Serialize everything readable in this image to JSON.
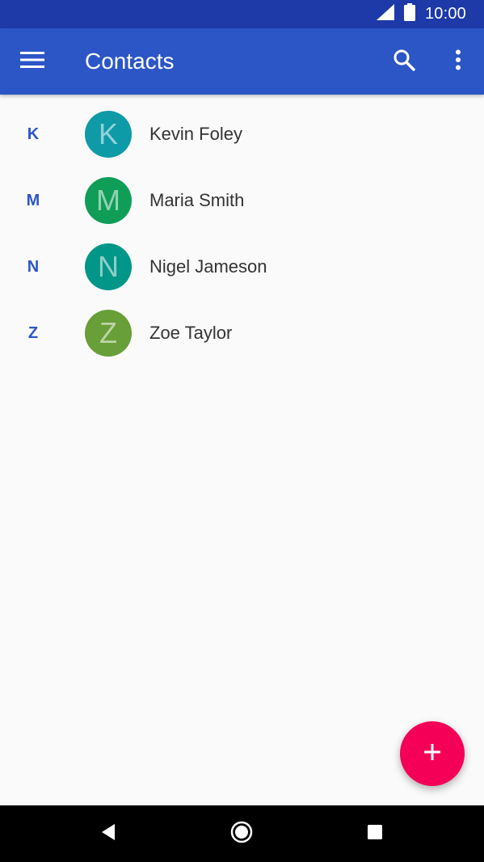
{
  "status_bar": {
    "time": "10:00",
    "icons": [
      "signal-icon",
      "battery-icon"
    ]
  },
  "app_bar": {
    "title": "Contacts",
    "icons": [
      "menu-icon",
      "search-icon",
      "more-vert-icon"
    ]
  },
  "contacts": [
    {
      "section": "K",
      "initial": "K",
      "name": "Kevin Foley",
      "color": "#0e9aa7"
    },
    {
      "section": "M",
      "initial": "M",
      "name": "Maria Smith",
      "color": "#0f9d58"
    },
    {
      "section": "N",
      "initial": "N",
      "name": "Nigel Jameson",
      "color": "#009688"
    },
    {
      "section": "Z",
      "initial": "Z",
      "name": "Zoe Taylor",
      "color": "#689f38"
    }
  ],
  "fab": {
    "icon": "plus-icon",
    "color": "#f50057"
  },
  "nav_bar": {
    "icons": [
      "back-icon",
      "home-icon",
      "recents-icon"
    ]
  },
  "colors": {
    "status_bar": "#1e3aa8",
    "app_bar": "#2c56c6",
    "section_letter": "#2c56c6",
    "background": "#fafafa"
  }
}
